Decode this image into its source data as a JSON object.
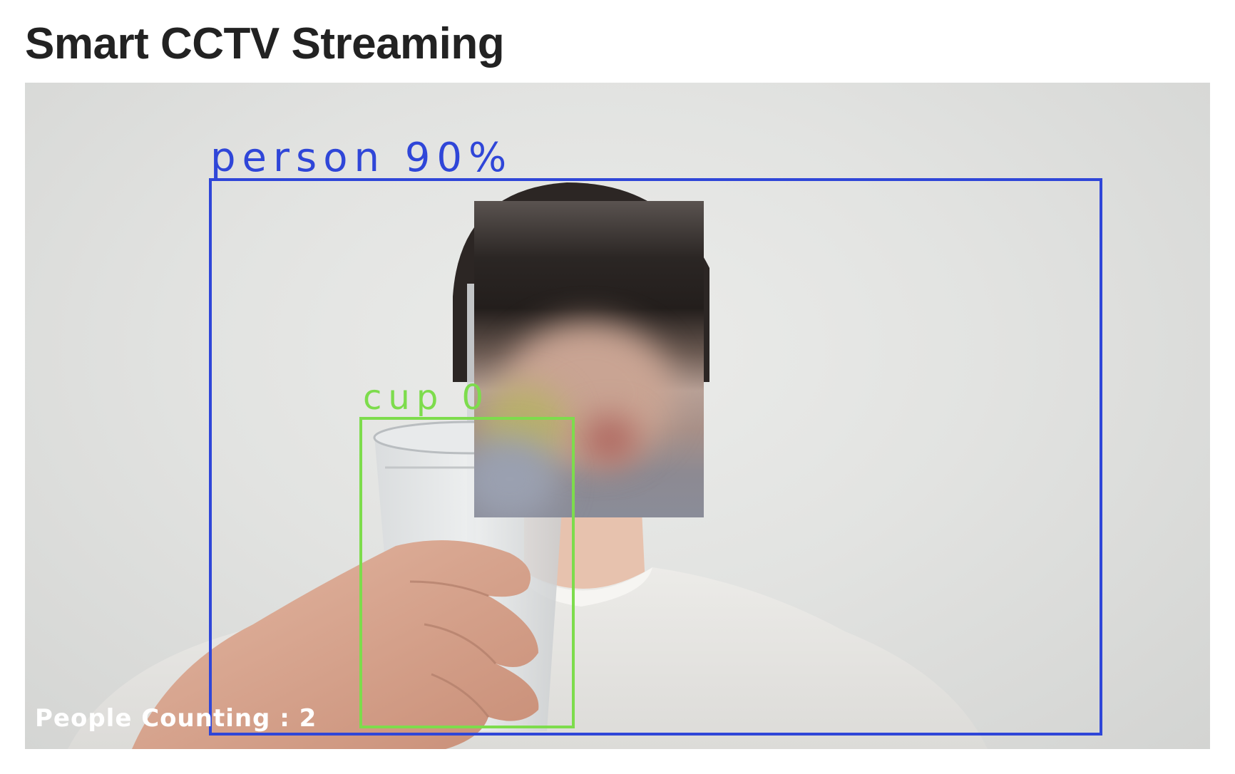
{
  "page": {
    "title": "Smart CCTV Streaming"
  },
  "stream": {
    "detections": [
      {
        "label": "person 90%",
        "color": "#2f46d8"
      },
      {
        "label": "cup 0",
        "color": "#7ddc4c"
      }
    ],
    "overlay_text": "People Counting : 2"
  }
}
